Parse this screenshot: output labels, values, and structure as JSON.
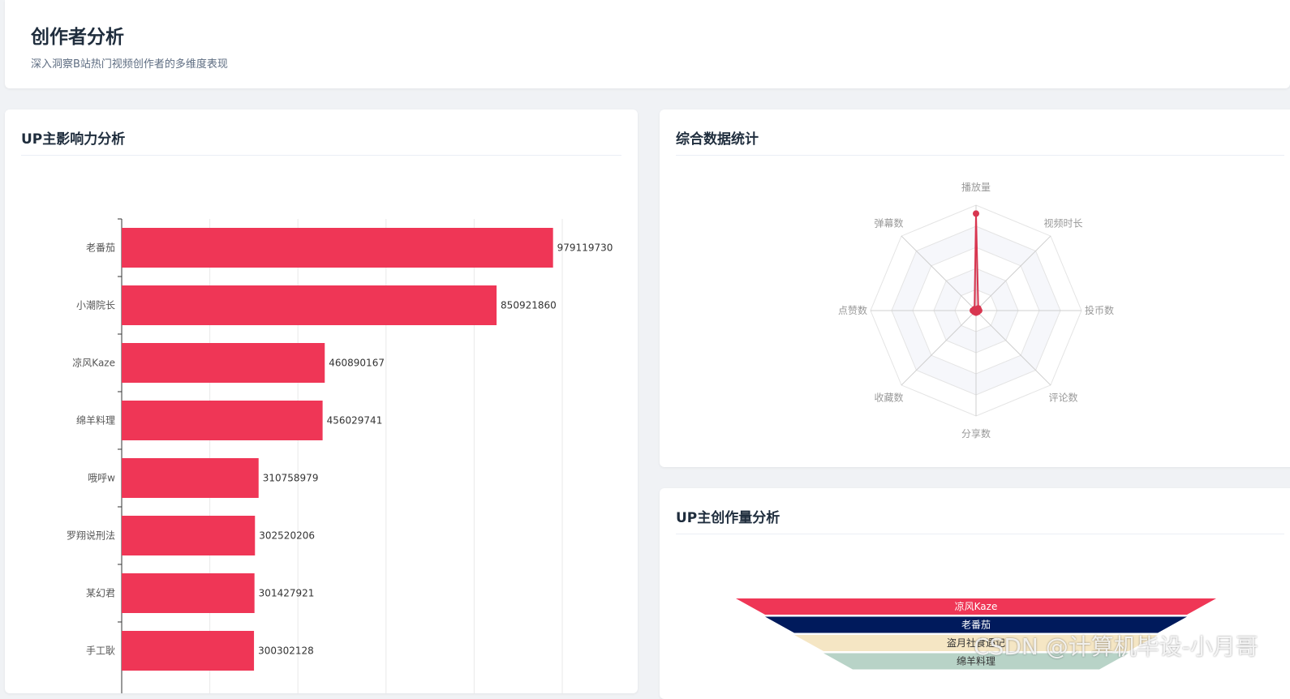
{
  "header": {
    "title": "创作者分析",
    "subtitle": "深入洞察B站热门视频创作者的多维度表现"
  },
  "influence": {
    "title": "UP主影响力分析",
    "chart_data": {
      "type": "bar",
      "orientation": "horizontal",
      "categories": [
        "老番茄",
        "小潮院长",
        "凉风Kaze",
        "绵羊料理",
        "哦呼w",
        "罗翔说刑法",
        "某幻君",
        "手工耿"
      ],
      "values": [
        979119730,
        850921860,
        460890167,
        456029741,
        310758979,
        302520206,
        301427921,
        300302128
      ],
      "xlim": [
        0,
        1000000000
      ],
      "color": "#ef3656",
      "grid": true,
      "data_labels": true
    }
  },
  "stats": {
    "title": "综合数据统计",
    "chart_data": {
      "type": "radar",
      "indicators": [
        "播放量",
        "视频时长",
        "投币数",
        "评论数",
        "分享数",
        "收藏数",
        "点赞数",
        "弹幕数"
      ],
      "values_normalized": [
        0.92,
        0.03,
        0.03,
        0.02,
        0.02,
        0.02,
        0.03,
        0.02
      ],
      "color": "#d83650",
      "rings": 5
    }
  },
  "volume": {
    "title": "UP主创作量分析",
    "chart_data": {
      "type": "funnel",
      "categories": [
        "凉风Kaze",
        "老番茄",
        "盗月社食遇记",
        "绵羊料理"
      ],
      "colors": [
        "#ef3656",
        "#001a5c",
        "#f5e6c4",
        "#b8d3c7"
      ],
      "text_colors": [
        "#ffffff",
        "#ffffff",
        "#333333",
        "#333333"
      ]
    }
  },
  "watermark": "CSDN @计算机毕设-小月哥"
}
